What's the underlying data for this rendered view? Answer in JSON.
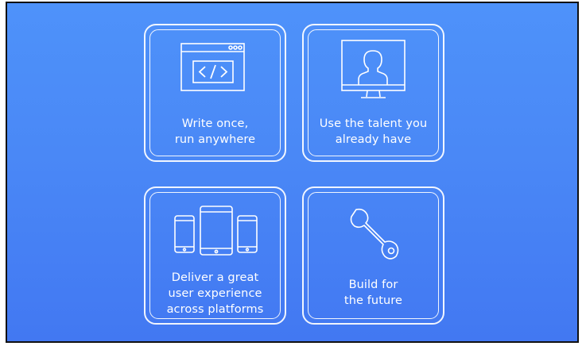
{
  "cards": [
    {
      "line1": "Write once,",
      "line2": "run anywhere",
      "line3": "",
      "icon": "code-window-icon"
    },
    {
      "line1": "Use the talent you",
      "line2": "already have",
      "line3": "",
      "icon": "person-monitor-icon"
    },
    {
      "line1": "Deliver a great",
      "line2": "user experience",
      "line3": "across platforms",
      "icon": "devices-icon"
    },
    {
      "line1": "Build for",
      "line2": "the future",
      "line3": "",
      "icon": "wrench-icon"
    }
  ],
  "colors": {
    "background_top": "#4e92fa",
    "background_bottom": "#4278f2",
    "line": "#ffffff"
  }
}
